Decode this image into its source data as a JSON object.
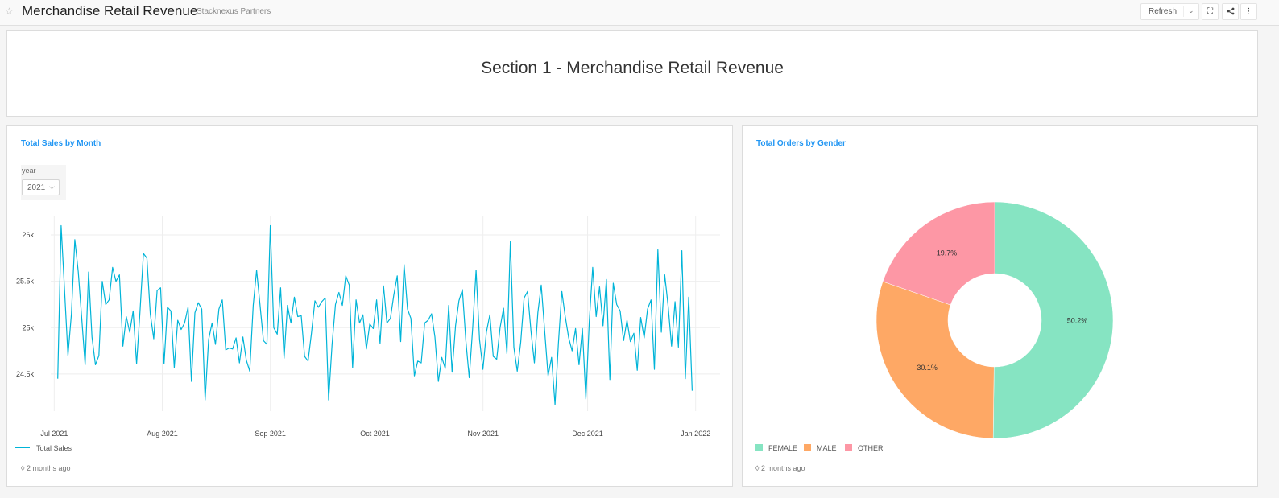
{
  "header": {
    "title": "Merchandise Retail Revenue",
    "owner": "Stacknexus Partners",
    "refresh_label": "Refresh",
    "icons": [
      "star-icon",
      "chevron-down-icon",
      "fullscreen-icon",
      "share-icon",
      "more-icon"
    ]
  },
  "section": {
    "title": "Section 1 - Merchandise Retail Revenue"
  },
  "sales_panel": {
    "title": "Total Sales by Month",
    "filter_label": "year",
    "filter_value": "2021",
    "legend": "Total Sales",
    "updated": "2 months ago"
  },
  "gender_panel": {
    "title": "Total Orders by Gender",
    "updated": "2 months ago"
  },
  "chart_data": [
    {
      "type": "line",
      "title": "Total Sales by Month",
      "xlabel": "",
      "ylabel": "",
      "x_ticks": [
        "Jul 2021",
        "Aug 2021",
        "Sep 2021",
        "Oct 2021",
        "Nov 2021",
        "Dec 2021",
        "Jan 2022"
      ],
      "y_ticks": [
        "24.5k",
        "25k",
        "25.5k",
        "26k"
      ],
      "ylim": [
        24100,
        26200
      ],
      "xlim": [
        "2021-06-30",
        "2022-01-08"
      ],
      "x_start": "2021-07-02",
      "x_end": "2021-12-31",
      "grid": true,
      "color": "#00b4d8",
      "series": [
        {
          "name": "Total Sales",
          "values": [
            24450,
            26100,
            25400,
            24700,
            25150,
            25950,
            25600,
            25100,
            24600,
            25600,
            24900,
            24600,
            24700,
            25500,
            25250,
            25300,
            25650,
            25500,
            25570,
            24800,
            25120,
            24950,
            25180,
            24610,
            25170,
            25800,
            25750,
            25150,
            24880,
            25400,
            25430,
            24610,
            25220,
            25180,
            24570,
            25080,
            24980,
            25050,
            25220,
            24420,
            25160,
            25270,
            25200,
            24220,
            24870,
            25050,
            24820,
            25200,
            25300,
            24760,
            24780,
            24770,
            24890,
            24620,
            24900,
            24650,
            24530,
            25240,
            25620,
            25240,
            24860,
            24820,
            26100,
            25000,
            24930,
            25430,
            24670,
            25240,
            25050,
            25330,
            25120,
            25130,
            24690,
            24640,
            24940,
            25290,
            25220,
            25280,
            25320,
            24220,
            24820,
            25250,
            25380,
            25240,
            25560,
            25460,
            24570,
            25300,
            25050,
            25140,
            24770,
            25040,
            24990,
            25300,
            24830,
            25450,
            25050,
            25100,
            25350,
            25560,
            24850,
            25680,
            25200,
            25100,
            24480,
            24640,
            24620,
            25050,
            25080,
            25150,
            24900,
            24420,
            24680,
            24560,
            25240,
            24520,
            25020,
            25290,
            25410,
            24860,
            24460,
            25000,
            25620,
            24870,
            24550,
            24950,
            25140,
            24690,
            24660,
            25000,
            25210,
            24720,
            25930,
            24790,
            24530,
            24840,
            25320,
            25390,
            24960,
            24620,
            25160,
            25460,
            24960,
            24480,
            24680,
            24170,
            24830,
            25390,
            25120,
            24890,
            24750,
            24990,
            24600,
            24990,
            24230,
            25060,
            25650,
            25120,
            25440,
            25020,
            25520,
            24440,
            25480,
            25250,
            25180,
            24860,
            25080,
            24850,
            24940,
            24540,
            25110,
            24890,
            25200,
            25300,
            24550,
            25840,
            24950,
            25570,
            25230,
            24800,
            25280,
            24790,
            25830,
            24450,
            25330,
            24320
          ]
        }
      ]
    },
    {
      "type": "pie",
      "title": "Total Orders by Gender",
      "donut": true,
      "categories": [
        "FEMALE",
        "MALE",
        "OTHER"
      ],
      "values": [
        50.2,
        30.1,
        19.7
      ],
      "labels": [
        "50.2%",
        "30.1%",
        "19.7%"
      ],
      "colors": [
        "#86e4c2",
        "#fea865",
        "#fd97a5"
      ],
      "legend_position": "bottom-left"
    }
  ]
}
